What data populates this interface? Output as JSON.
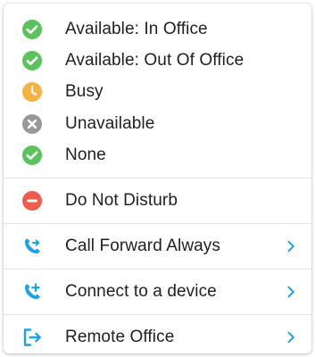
{
  "colors": {
    "available": "#5ac35c",
    "busy": "#f7b13f",
    "unavailable": "#999999",
    "dnd": "#ef5b4c",
    "accent": "#1aa3e8",
    "text": "#202124",
    "divider": "#e3e3e3"
  },
  "statuses": [
    {
      "label": "Available: In Office",
      "icon": "check-circle-icon"
    },
    {
      "label": "Available: Out Of Office",
      "icon": "check-circle-icon"
    },
    {
      "label": "Busy",
      "icon": "clock-icon"
    },
    {
      "label": "Unavailable",
      "icon": "x-circle-icon"
    },
    {
      "label": "None",
      "icon": "check-circle-icon"
    }
  ],
  "actions": {
    "do_not_disturb": {
      "label": "Do Not Disturb",
      "icon": "minus-circle-icon"
    },
    "call_forward": {
      "label": "Call Forward Always",
      "icon": "phone-forward-icon"
    },
    "connect_device": {
      "label": "Connect to a device",
      "icon": "phone-add-icon"
    },
    "remote_office": {
      "label": "Remote Office",
      "icon": "exit-arrow-icon"
    }
  }
}
